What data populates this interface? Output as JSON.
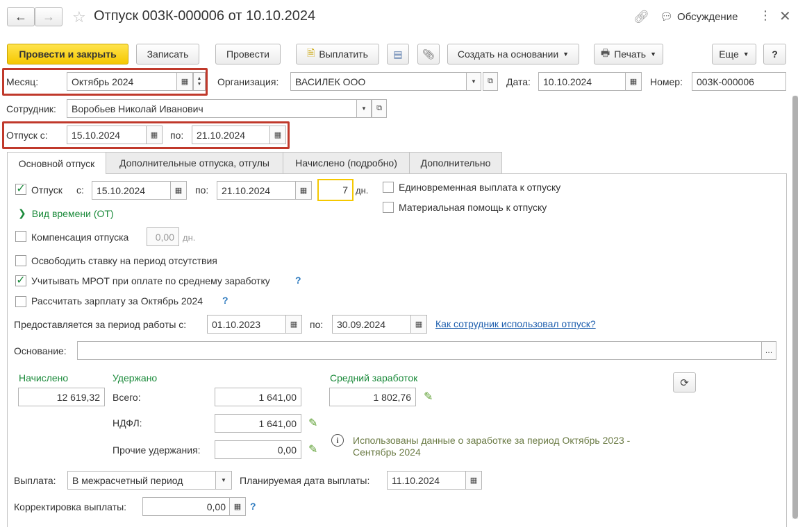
{
  "window": {
    "title": "Отпуск 003К-000006 от 10.10.2024",
    "discussion_label": "Обсуждение"
  },
  "toolbar": {
    "post_close": "Провести и закрыть",
    "save": "Записать",
    "post": "Провести",
    "pay": "Выплатить",
    "create_based": "Создать на основании",
    "print": "Печать",
    "more": "Еще",
    "help": "?"
  },
  "header": {
    "month_label": "Месяц:",
    "month_value": "Октябрь 2024",
    "org_label": "Организация:",
    "org_value": "ВАСИЛЕК ООО",
    "date_label": "Дата:",
    "date_value": "10.10.2024",
    "number_label": "Номер:",
    "number_value": "003К-000006",
    "employee_label": "Сотрудник:",
    "employee_value": "Воробьев Николай Иванович",
    "vac_from_label": "Отпуск с:",
    "vac_from_value": "15.10.2024",
    "vac_to_label": "по:",
    "vac_to_value": "21.10.2024"
  },
  "tabs": [
    {
      "label": "Основной отпуск"
    },
    {
      "label": "Дополнительные отпуска, отгулы"
    },
    {
      "label": "Начислено (подробно)"
    },
    {
      "label": "Дополнительно"
    }
  ],
  "main": {
    "vacation_check_label": "Отпуск",
    "from_label": "с:",
    "from_value": "15.10.2024",
    "to_label": "по:",
    "to_value": "21.10.2024",
    "days_value": "7",
    "days_unit": "дн.",
    "time_kind_label": "Вид времени (ОТ)",
    "lump_sum_label": "Единовременная выплата к отпуску",
    "material_help_label": "Материальная помощь к отпуску",
    "compensation_label": "Компенсация отпуска",
    "compensation_value": "0,00",
    "compensation_unit": "дн.",
    "release_rate_label": "Освободить ставку на период отсутствия",
    "mrot_label": "Учитывать МРОТ при оплате по среднему заработку",
    "calc_salary_label": "Рассчитать зарплату за Октябрь 2024",
    "period_label": "Предоставляется за период работы с:",
    "period_from": "01.10.2023",
    "period_to_label": "по:",
    "period_to": "30.09.2024",
    "usage_link": "Как сотрудник использовал отпуск?",
    "basis_label": "Основание:",
    "basis_value": "",
    "accrued_header": "Начислено",
    "accrued_value": "12 619,32",
    "withheld_header": "Удержано",
    "total_label": "Всего:",
    "total_value": "1 641,00",
    "ndfl_label": "НДФЛ:",
    "ndfl_value": "1 641,00",
    "other_label": "Прочие удержания:",
    "other_value": "0,00",
    "avg_header": "Средний заработок",
    "avg_value": "1 802,76",
    "info_text_1": "Использованы данные о заработке за период Октябрь 2023 -",
    "info_text_2": "Сентябрь 2024",
    "payment_label": "Выплата:",
    "payment_value": "В межрасчетный период",
    "planned_date_label": "Планируемая дата выплаты:",
    "planned_date_value": "11.10.2024",
    "correction_label": "Корректировка выплаты:",
    "correction_value": "0,00"
  },
  "colors": {
    "accent_yellow": "#f5c800",
    "highlight_red": "#c0392b",
    "green_text": "#1a8a3a",
    "link_blue": "#1f5fae"
  }
}
